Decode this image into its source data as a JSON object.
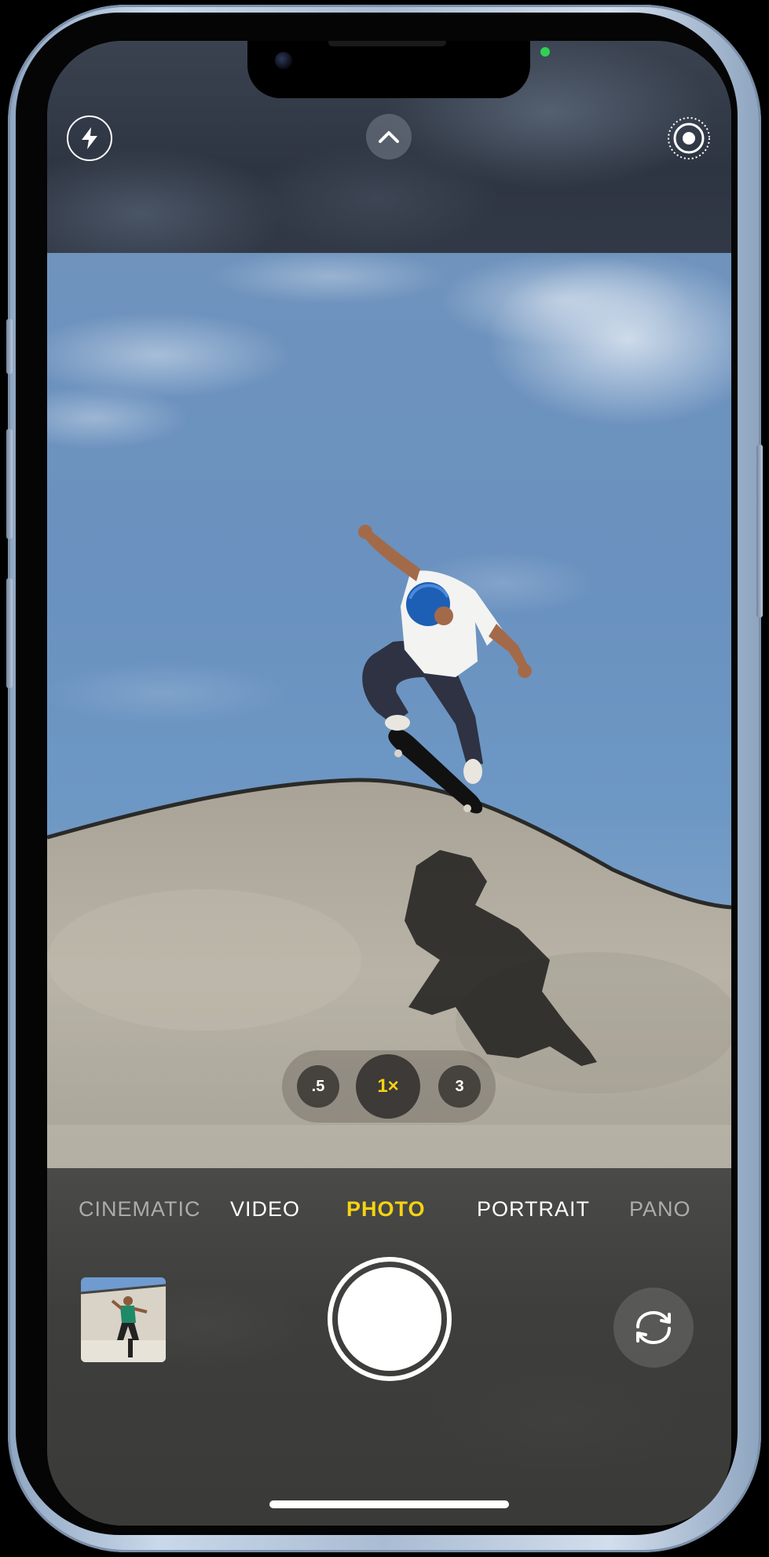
{
  "camera": {
    "modes": {
      "cinematic": "CINEMATIC",
      "video": "VIDEO",
      "photo": "PHOTO",
      "portrait": "PORTRAIT",
      "pano": "PANO"
    },
    "selected_mode": "PHOTO",
    "zoom": {
      "half": ".5",
      "one": "1×",
      "three": "3",
      "selected": "1×"
    },
    "icons": {
      "flash": "flash-icon",
      "expand": "chevron-up-icon",
      "live_photo": "live-photo-icon",
      "flip_camera": "flip-camera-icon"
    },
    "colors": {
      "accent_yellow": "#f6d312",
      "camera_in_use_indicator": "#2fd154"
    }
  }
}
